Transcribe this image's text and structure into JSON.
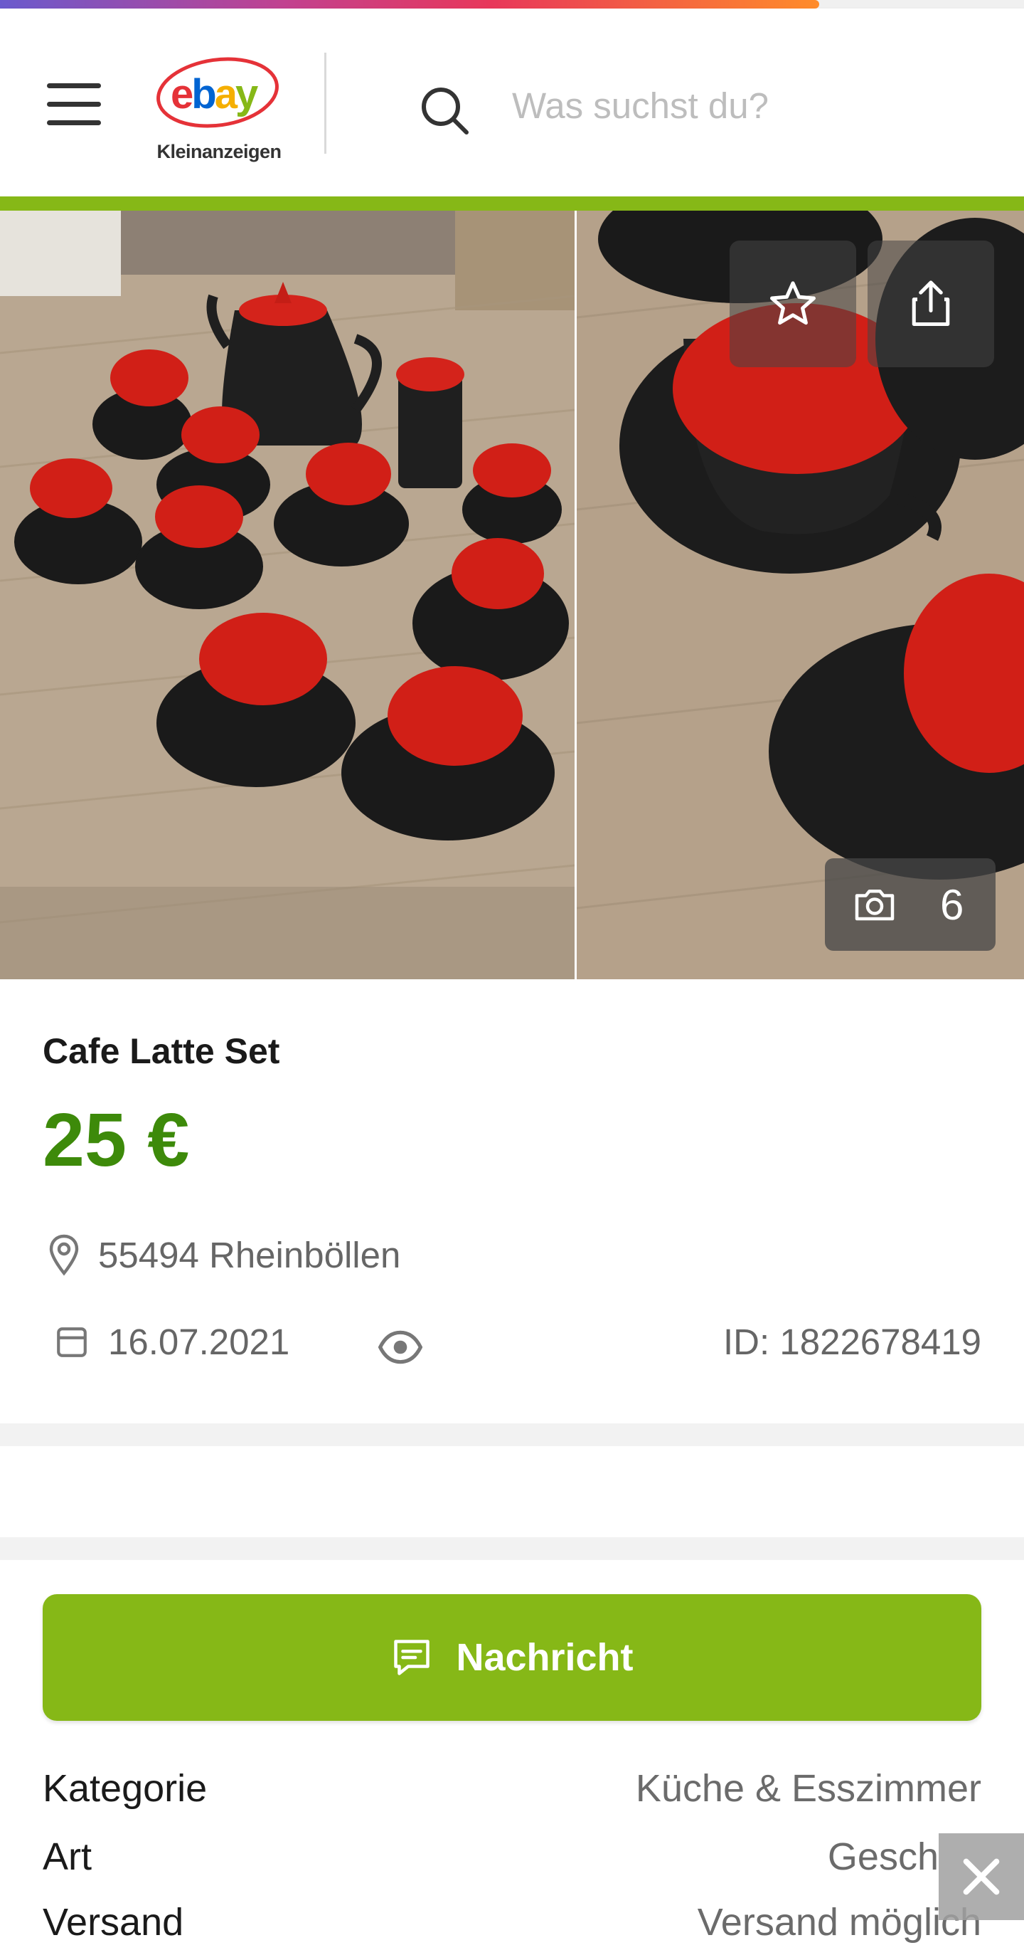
{
  "header": {
    "logo_wordmark": "ebay",
    "logo_subtitle": "Kleinanzeigen",
    "search_placeholder": "Was suchst du?",
    "menu_icon": "hamburger-menu-icon",
    "search_icon": "magnifier-icon"
  },
  "colors": {
    "brand_green": "#86b817",
    "price_green": "#3d8a0a",
    "ebay_red": "#e53238",
    "ebay_blue": "#0064d2",
    "ebay_yellow": "#f5af02",
    "ebay_green": "#86b817"
  },
  "loading": {
    "progress_percent": 80
  },
  "gallery": {
    "photo_count": "6",
    "favorite_icon": "star-icon",
    "share_icon": "share-icon",
    "camera_icon": "camera-icon"
  },
  "listing": {
    "title": "Cafe Latte Set",
    "price": "25 €",
    "location": "55494 Rheinböllen",
    "date": "16.07.2021",
    "id_text": "ID: 1822678419"
  },
  "actions": {
    "message_label": "Nachricht"
  },
  "details": [
    {
      "key": "Kategorie",
      "value": "Küche & Esszimmer"
    },
    {
      "key": "Art",
      "value": "Gesch"
    },
    {
      "key": "Versand",
      "value": "Versand möglich"
    }
  ]
}
